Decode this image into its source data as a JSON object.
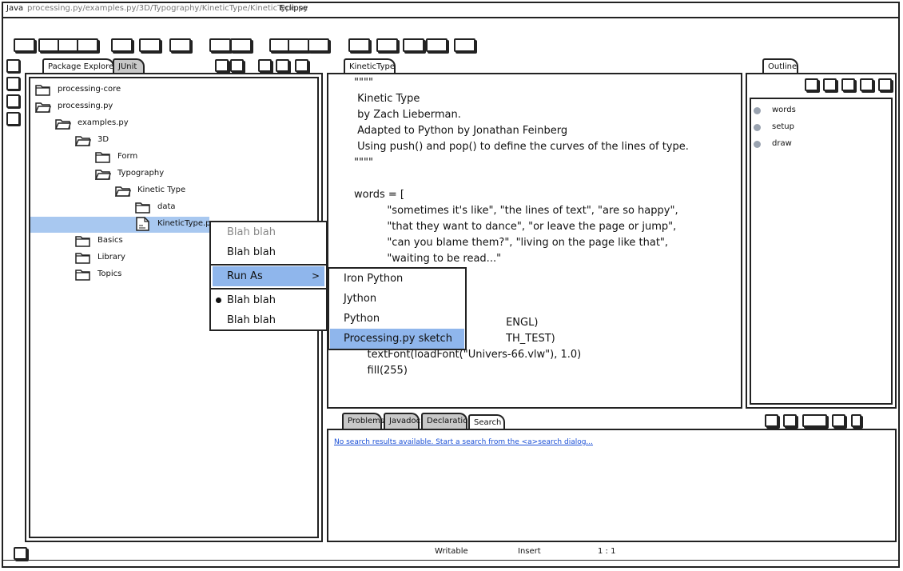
{
  "titlebar": {
    "app": "Java",
    "path": "processing.py/examples.py/3D/Typography/KineticType/KineticType.py",
    "ide": "Eclipse"
  },
  "package_explorer": {
    "tab_label": "Package Explorer",
    "junit_label": "JUnit",
    "tree": [
      {
        "label": "processing-core",
        "icon": "folder-icon"
      },
      {
        "label": "processing.py",
        "icon": "folder-open-icon"
      },
      {
        "label": "examples.py",
        "icon": "folder-open-icon"
      },
      {
        "label": "3D",
        "icon": "folder-open-icon"
      },
      {
        "label": "Form",
        "icon": "folder-icon"
      },
      {
        "label": "Typography",
        "icon": "folder-open-icon"
      },
      {
        "label": "Kinetic Type",
        "icon": "folder-open-icon"
      },
      {
        "label": "data",
        "icon": "folder-icon"
      },
      {
        "label": "KineticType.py",
        "icon": "file-icon",
        "selected": true
      },
      {
        "label": "Basics",
        "icon": "folder-icon"
      },
      {
        "label": "Library",
        "icon": "folder-icon"
      },
      {
        "label": "Topics",
        "icon": "folder-icon"
      }
    ]
  },
  "editor": {
    "tab_label": "KineticType",
    "lines": [
      "\"\"\"\"",
      " Kinetic Type",
      " by Zach Lieberman.",
      " Adapted to Python by Jonathan Feinberg",
      " Using push() and pop() to define the curves of the lines of type.",
      "\"\"\"\"",
      "",
      "words = [",
      "          \"sometimes it's like\", \"the lines of text\", \"are so happy\",",
      "          \"that they want to dance\", \"or leave the page or jump\",",
      "          \"can you blame them?\", \"living on the page like that\",",
      "          \"waiting to be read...\"",
      "",
      "",
      "",
      "                                              ENGL)",
      "                                              TH_TEST)",
      "    textFont(loadFont(\"Univers-66.vlw\"), 1.0)",
      "    fill(255)"
    ]
  },
  "context_menu": {
    "items": [
      {
        "label": "Blah blah",
        "disabled": true
      },
      {
        "label": "Blah blah"
      },
      {
        "label": "Run As",
        "submenu": true,
        "highlighted": true
      },
      {
        "label": "Blah blah",
        "bullet": true
      },
      {
        "label": "Blah blah"
      }
    ],
    "submenu_arrow": ">"
  },
  "run_as_submenu": {
    "items": [
      {
        "label": "Iron Python"
      },
      {
        "label": "Jython"
      },
      {
        "label": "Python"
      },
      {
        "label": "Processing.py sketch",
        "highlighted": true
      }
    ]
  },
  "outline": {
    "tab_label": "Outline",
    "items": [
      "words",
      "setup",
      "draw"
    ]
  },
  "bottom_panel": {
    "tabs": [
      "Problems",
      "Javadoc",
      "Declaration",
      "Search"
    ],
    "active_tab": "Search",
    "message": "No search results available. Start a search from the <a>search dialog..."
  },
  "statusbar": {
    "mode": "Writable",
    "insert": "Insert",
    "position": "1 : 1"
  },
  "colors": {
    "selection": "#a8c8f0",
    "highlight": "#8fb6ec",
    "link": "#1a4fd6",
    "inactive_tab": "#c8c8c8"
  }
}
